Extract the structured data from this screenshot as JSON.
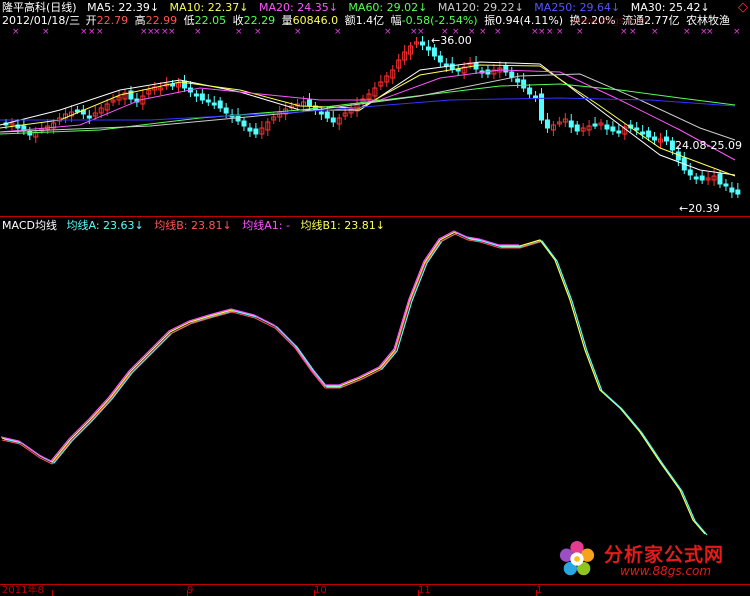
{
  "header": {
    "stock_title": "隆平高科(日线)",
    "ma": [
      {
        "label": "MA5:",
        "value": "22.39",
        "color": "#ffffff"
      },
      {
        "label": "MA10:",
        "value": "22.37",
        "color": "#ffff55"
      },
      {
        "label": "MA20:",
        "value": "24.35",
        "color": "#ff55ff"
      },
      {
        "label": "MA60:",
        "value": "29.02",
        "color": "#55ff55"
      },
      {
        "label": "MA120:",
        "value": "29.22",
        "color": "#cccccc"
      },
      {
        "label": "MA250:",
        "value": "29.64",
        "color": "#5555ff"
      },
      {
        "label": "MA30:",
        "value": "25.42",
        "color": "#ffffff"
      }
    ],
    "ma_arrow": "↓",
    "quote": {
      "date": "2012/01/18/三",
      "open_label": "开",
      "open": "22.79",
      "high_label": "高",
      "high": "22.99",
      "low_label": "低",
      "low": "22.05",
      "close_label": "收",
      "close": "22.29",
      "volume_label": "量",
      "volume": "60846.0",
      "amount_label": "额",
      "amount": "1.4亿",
      "change_label": "幅",
      "change": "-0.58(-2.54%)",
      "amplitude_label": "振",
      "amplitude": "0.94(4.11%)",
      "turnover_label": "换",
      "turnover": "2.20%",
      "float_label": "流通",
      "float": "2.77亿",
      "sector": "农林牧渔"
    },
    "corner_icon": "diamond-icon"
  },
  "watermark": "www.88gs.com",
  "kline": {
    "high_annotation": "36.00",
    "low_annotation": "20.39",
    "date_range": "24.08-25.09"
  },
  "macd": {
    "title": "MACD均线",
    "lines": [
      {
        "label": "均线A:",
        "value": "23.63",
        "color": "#55ffff"
      },
      {
        "label": "均线B:",
        "value": "23.81",
        "color": "#ff5555"
      },
      {
        "label": "均线A1:",
        "value": "-",
        "color": "#ff55ff"
      },
      {
        "label": "均线B1:",
        "value": "23.81",
        "color": "#ffff55"
      }
    ],
    "arrow": "↓"
  },
  "axis": {
    "labels": [
      "2011年8",
      "9",
      "10",
      "11",
      "1"
    ]
  },
  "logo": {
    "name": "分析家公式网",
    "url": "www.88gs.com"
  },
  "colors": {
    "up": "#ff3030",
    "down": "#55ffff",
    "grid": "#c00000"
  }
}
